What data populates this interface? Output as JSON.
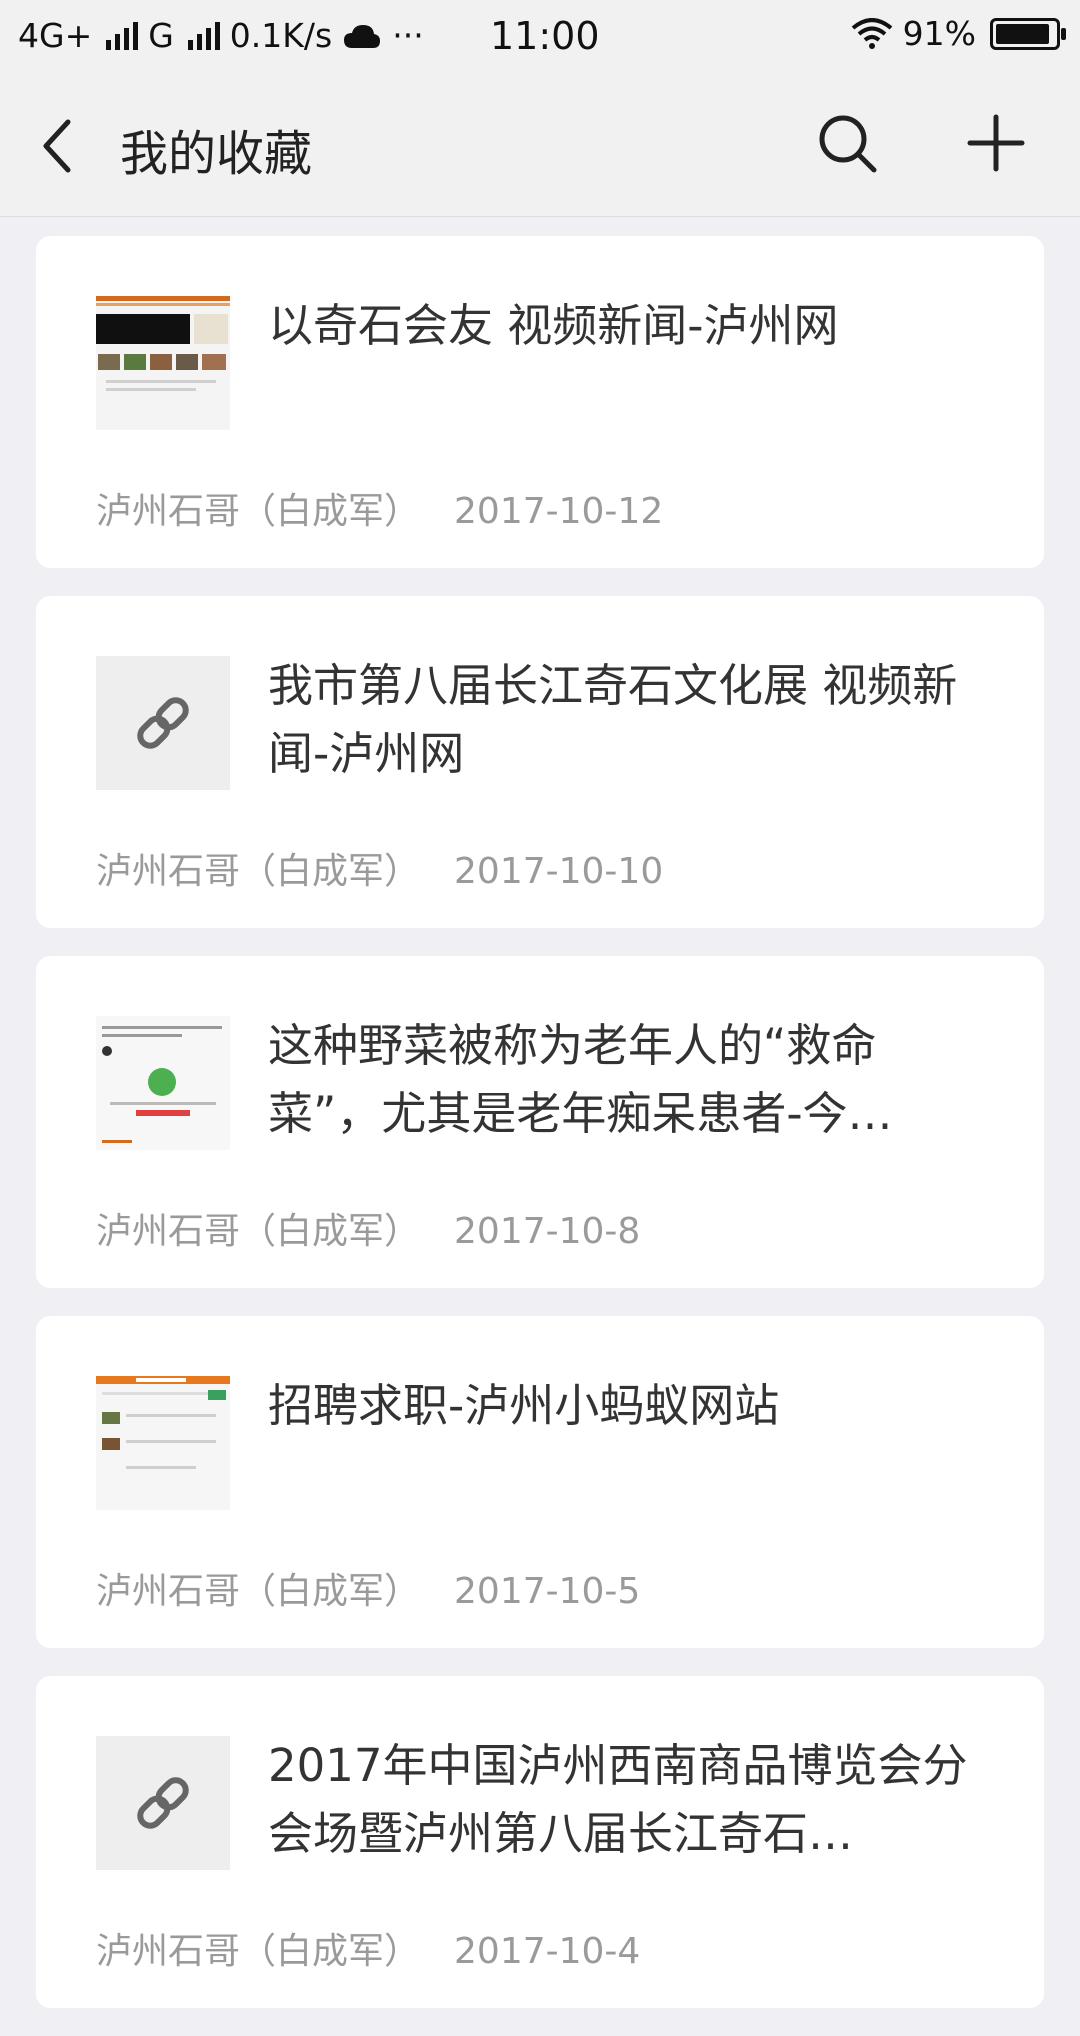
{
  "status_bar": {
    "network_1": "4G+",
    "network_2": "G",
    "speed": "0.1K/s",
    "dots": "···",
    "time": "11:00",
    "battery_pct": "91%",
    "battery_level": 0.91
  },
  "header": {
    "title": "我的收藏",
    "icons": [
      "back-arrow-icon",
      "search-icon",
      "plus-icon"
    ]
  },
  "favorites": [
    {
      "title": "以奇石会友 视频新闻-泸州网",
      "author": "泸州石哥（白成军）",
      "date": "2017-10-12",
      "thumb": "webpage-screenshot"
    },
    {
      "title": "我市第八届长江奇石文化展 视频新闻-泸州网",
      "author": "泸州石哥（白成军）",
      "date": "2017-10-10",
      "thumb": "link-icon"
    },
    {
      "title": "这种野菜被称为老年人的“救命菜”，尤其是老年痴呆患者-今…",
      "author": "泸州石哥（白成军）",
      "date": "2017-10-8",
      "thumb": "webpage-screenshot"
    },
    {
      "title": "招聘求职-泸州小蚂蚁网站",
      "author": "泸州石哥（白成军）",
      "date": "2017-10-5",
      "thumb": "webpage-screenshot"
    },
    {
      "title": "2017年中国泸州西南商品博览会分会场暨泸州第八届长江奇石…",
      "author": "泸州石哥（白成军）",
      "date": "2017-10-4",
      "thumb": "link-icon"
    }
  ]
}
